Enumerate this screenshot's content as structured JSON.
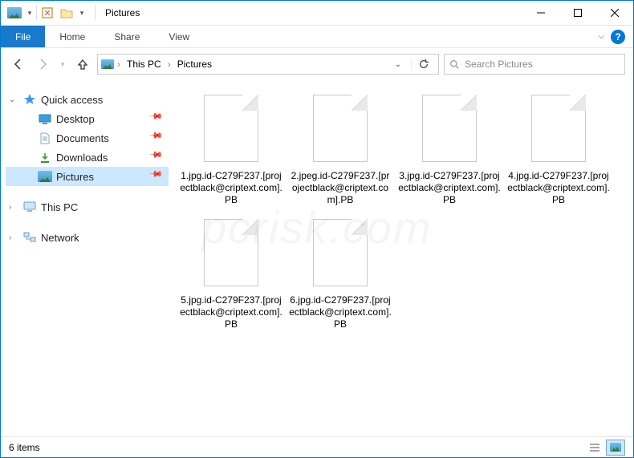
{
  "window": {
    "title": "Pictures"
  },
  "ribbon": {
    "file": "File",
    "tabs": [
      "Home",
      "Share",
      "View"
    ]
  },
  "breadcrumb": {
    "root": "This PC",
    "current": "Pictures"
  },
  "search": {
    "placeholder": "Search Pictures"
  },
  "nav": {
    "quick_access": "Quick access",
    "items": [
      {
        "label": "Desktop",
        "pinned": true
      },
      {
        "label": "Documents",
        "pinned": true
      },
      {
        "label": "Downloads",
        "pinned": true
      },
      {
        "label": "Pictures",
        "pinned": true,
        "selected": true
      }
    ],
    "this_pc": "This PC",
    "network": "Network"
  },
  "files": [
    {
      "name": "1.jpg.id-C279F237.[projectblack@criptext.com].PB"
    },
    {
      "name": "2.jpeg.id-C279F237.[projectblack@criptext.com].PB"
    },
    {
      "name": "3.jpg.id-C279F237.[projectblack@criptext.com].PB"
    },
    {
      "name": "4.jpg.id-C279F237.[projectblack@criptext.com].PB"
    },
    {
      "name": "5.jpg.id-C279F237.[projectblack@criptext.com].PB"
    },
    {
      "name": "6.jpg.id-C279F237.[projectblack@criptext.com].PB"
    }
  ],
  "status": {
    "count": "6 items"
  }
}
